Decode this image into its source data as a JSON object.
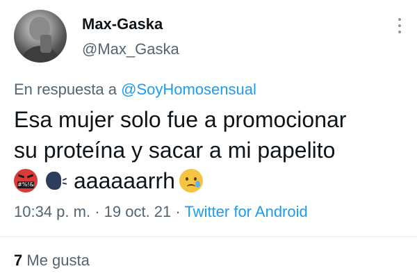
{
  "author": {
    "name": "Max-Gaska",
    "handle": "@Max_Gaska",
    "avatar_icon": "profile-photo"
  },
  "reply_to": {
    "prefix": "En respuesta a",
    "mention": "@SoyHomosensual"
  },
  "tweet": {
    "line1": "Esa mujer solo fue a promocionar",
    "line2": "su proteína y sacar a mi papelito",
    "emoji_1": "face-with-symbols-on-mouth",
    "emoji_1_symbols": "#%!&",
    "emoji_2": "speaking-head",
    "line3_text": "aaaaaarrh",
    "emoji_3": "crying-face"
  },
  "meta": {
    "time": "10:34 p. m.",
    "sep1": " · ",
    "date": "19 oct. 21",
    "sep2": " · ",
    "source": "Twitter for Android"
  },
  "stats": {
    "likes_count": "7",
    "likes_label": "Me gusta"
  },
  "colors": {
    "link": "#1d9bf0",
    "secondary_text": "#536471",
    "primary_text": "#0f1419"
  }
}
